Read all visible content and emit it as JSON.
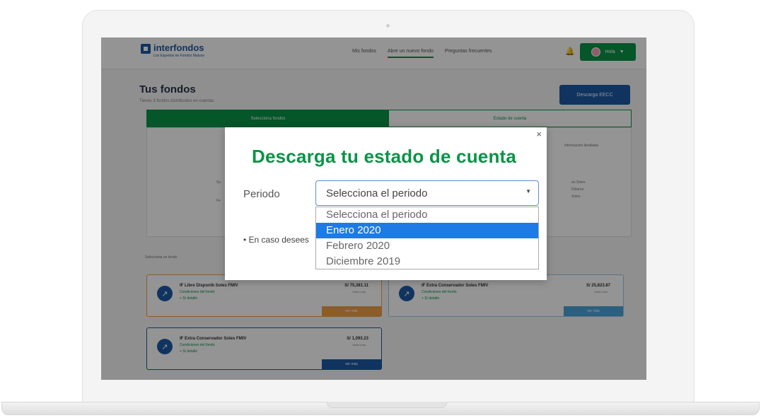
{
  "app": {
    "logo_name": "interfondos",
    "logo_tagline": "Los Expertos en Fondos Mutuos"
  },
  "nav": {
    "links": [
      "Mis fondos",
      "Abre un nuevo fondo",
      "Preguntas frecuentes"
    ],
    "active_index": 1,
    "user_label": "Hola"
  },
  "page": {
    "title": "Tus fondos",
    "subtitle": "Tienes 3 fondos distribuidos en cuentas",
    "download_button": "Descarga EECC",
    "tabs": [
      "Selecciona fondos",
      "Estado de cuenta"
    ],
    "info_left": [
      "Su",
      "Fe"
    ],
    "info_right": [
      "Información detallada",
      "en Soles",
      "Dólares",
      "Soles"
    ],
    "fund_list_label": "Selecciona un fondo"
  },
  "funds": [
    {
      "name": "IF Libre Disponib Soles FMIV",
      "sub": "Condiciones del fondo",
      "extra": "+ S/ detalle",
      "amount": "S/ 75,381.11",
      "caption": "Saldo total",
      "button": "ver más"
    },
    {
      "name": "IF Extra Conservador Soles FMIV",
      "sub": "Condiciones del fondo",
      "extra": "+ S/ detalle",
      "amount": "S/ 25,823.87",
      "caption": "Saldo total",
      "button": "ver más"
    },
    {
      "name": "IF Extra Conservador Soles FMIV",
      "sub": "Condiciones del fondo",
      "extra": "+ S/ detalle",
      "amount": "S/ 1,093.23",
      "caption": "Saldo total",
      "button": "ver más"
    }
  ],
  "modal": {
    "close_symbol": "×",
    "title": "Descarga tu estado de cuenta",
    "period_label": "Periodo",
    "select_value": "Selecciona el periodo",
    "options": [
      "Selecciona el periodo",
      "Enero 2020",
      "Febrero 2020",
      "Diciembre 2019"
    ],
    "highlighted_index": 1,
    "note": "• En caso desees"
  },
  "icons": {
    "bell": "bell-icon",
    "chevron": "chevron-down-icon",
    "fund": "chart-icon"
  },
  "colors": {
    "brand_green": "#0a9448",
    "brand_blue": "#1d5aa4",
    "accent_orange": "#f0a14b",
    "highlight_blue": "#1e7ae4"
  }
}
